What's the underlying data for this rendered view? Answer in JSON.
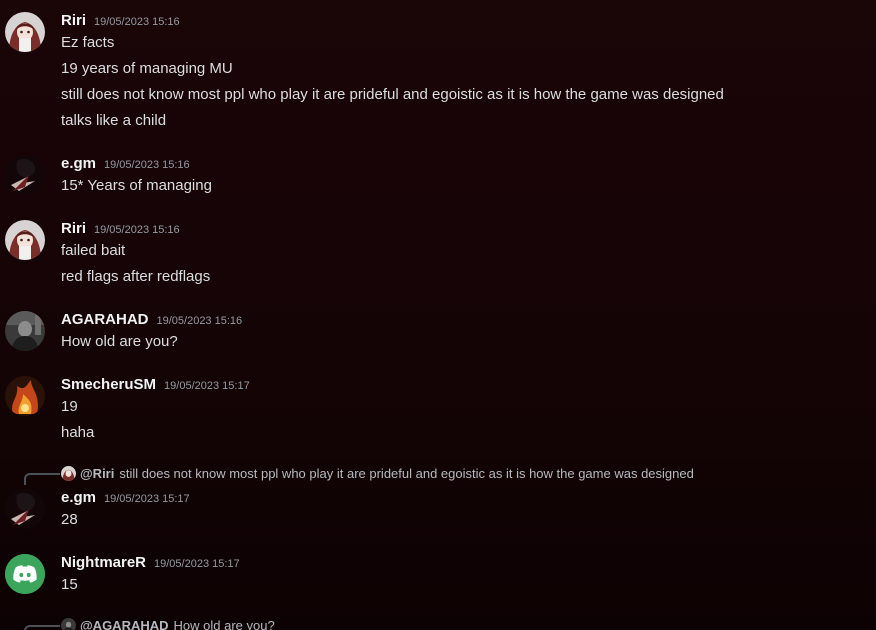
{
  "messages": [
    {
      "author": "Riri",
      "timestamp": "19/05/2023 15:16",
      "avatar_icon": "anime-girl-avatar-icon",
      "lines": [
        "Ez facts",
        "19 years of managing MU",
        "still does not know most ppl who play it are prideful and egoistic as it is how the game was designed",
        "talks like a child"
      ]
    },
    {
      "author": "e.gm",
      "timestamp": "19/05/2023 15:16",
      "avatar_icon": "dark-character-avatar-icon",
      "lines": [
        "15* Years of managing"
      ]
    },
    {
      "author": "Riri",
      "timestamp": "19/05/2023 15:16",
      "avatar_icon": "anime-girl-avatar-icon",
      "lines": [
        "failed bait",
        "red flags after redflags"
      ]
    },
    {
      "author": "AGARAHAD",
      "timestamp": "19/05/2023 15:16",
      "avatar_icon": "grey-photo-avatar-icon",
      "lines": [
        "How old are you?"
      ]
    },
    {
      "author": "SmecheruSM",
      "timestamp": "19/05/2023 15:17",
      "avatar_icon": "fire-avatar-icon",
      "lines": [
        "19",
        "haha"
      ]
    },
    {
      "author": "e.gm",
      "timestamp": "19/05/2023 15:17",
      "avatar_icon": "dark-character-avatar-icon",
      "reply": {
        "mention": "@Riri",
        "text": "still does not know most ppl who play it are prideful and egoistic as it is how the game was designed"
      },
      "lines": [
        "28"
      ]
    },
    {
      "author": "NightmareR",
      "timestamp": "19/05/2023 15:17",
      "avatar_icon": "discord-logo-avatar-icon",
      "lines": [
        "15"
      ]
    },
    {
      "reply": {
        "mention": "@AGARAHAD",
        "text": "How old are you?"
      }
    }
  ],
  "colors": {
    "background_top": "#1a0507",
    "background_bottom": "#0d0203",
    "username": "#f2f3f5",
    "message_text": "#dbdee1",
    "timestamp": "#949ba4",
    "discord_green": "#3ba55c"
  }
}
